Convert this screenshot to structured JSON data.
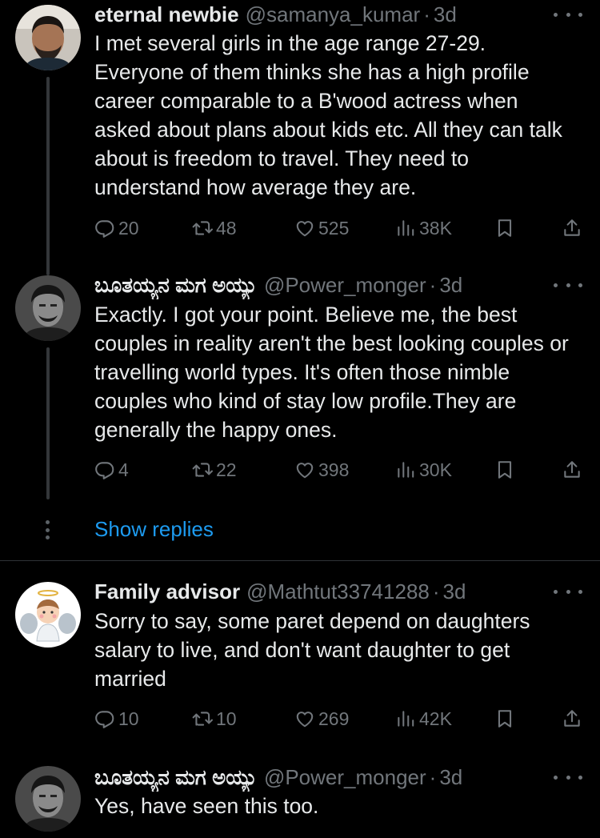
{
  "tweets": [
    {
      "name": "eternal newbie",
      "handle": "@samanya_kumar",
      "time": "3d",
      "text": "I met several girls in the age range 27-29. Everyone of them thinks she has a high profile career comparable to a B'wood actress when asked about plans about kids etc. All they can talk about is freedom to travel. They need to understand how average they are.",
      "replies": "20",
      "retweets": "48",
      "likes": "525",
      "views": "38K"
    },
    {
      "name": "ಬೂತಯ್ಯನ ಮಗ ಅಯ್ಯು",
      "handle": "@Power_monger",
      "time": "3d",
      "text": "Exactly. I got your point. Believe me, the best couples in reality aren't the best looking couples or travelling world types. It's often those nimble couples who kind of stay low profile.They are generally the happy ones.",
      "replies": "4",
      "retweets": "22",
      "likes": "398",
      "views": "30K"
    },
    {
      "name": "Family advisor",
      "handle": "@Mathtut33741288",
      "time": "3d",
      "text": "Sorry to say, some paret depend on daughters salary to live, and don't want daughter to get married",
      "replies": "10",
      "retweets": "10",
      "likes": "269",
      "views": "42K"
    },
    {
      "name": "ಬೂತಯ್ಯನ ಮಗ ಅಯ್ಯು",
      "handle": "@Power_monger",
      "time": "3d",
      "text": "Yes, have seen this too."
    }
  ],
  "show_replies_label": "Show replies",
  "icons": {
    "reply": "reply-icon",
    "retweet": "retweet-icon",
    "like": "like-icon",
    "views": "views-icon",
    "bookmark": "bookmark-icon",
    "share": "share-icon",
    "more": "more-icon"
  },
  "colors": {
    "background": "#000000",
    "text": "#e7e9ea",
    "muted": "#71767b",
    "link": "#1d9bf0",
    "divider": "#2f3336"
  }
}
